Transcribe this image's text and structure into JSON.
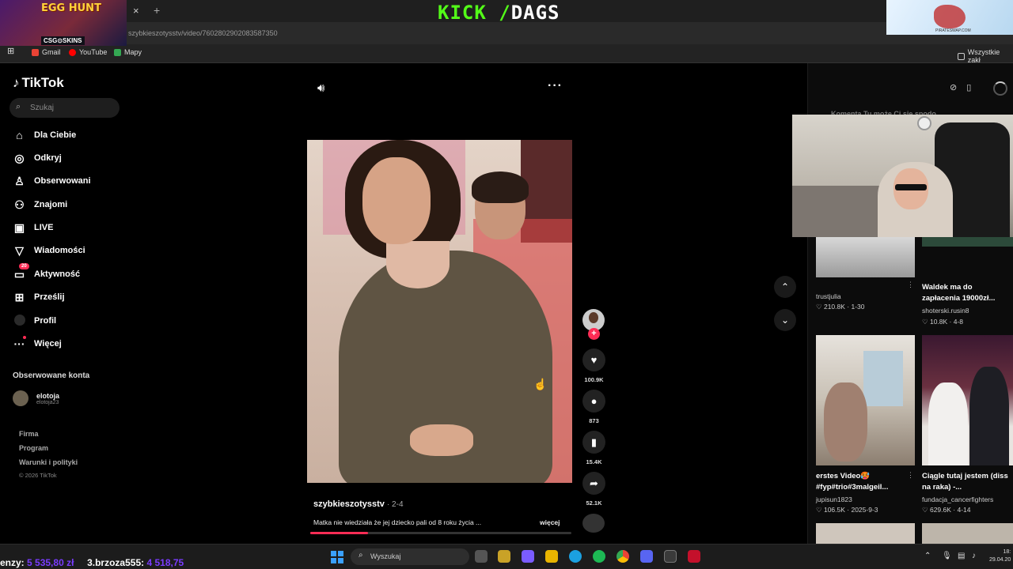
{
  "browser": {
    "tab_close": "×",
    "tab_new": "+",
    "url": "szybkieszotysstv/video/7602802902083587350",
    "bookmarks": [
      "Gmail",
      "YouTube",
      "Mapy"
    ],
    "bookmarks_right": "Wszystkie zakł",
    "apps_icon": "⊞"
  },
  "overlay": {
    "egg_hunt": "EGG HUNT",
    "csgo_skins": "CSG⊙SKINS",
    "kick": "KICK /",
    "dags": "DAGS",
    "corner_tag": "PIRATESWAP.COM"
  },
  "sidebar": {
    "logo": "TikTok",
    "search_placeholder": "Szukaj",
    "nav": [
      {
        "label": "Dla Ciebie",
        "icon": "home-icon"
      },
      {
        "label": "Odkryj",
        "icon": "compass-icon"
      },
      {
        "label": "Obserwowani",
        "icon": "person-icon"
      },
      {
        "label": "Znajomi",
        "icon": "friends-icon"
      },
      {
        "label": "LIVE",
        "icon": "live-icon"
      },
      {
        "label": "Wiadomości",
        "icon": "send-icon"
      },
      {
        "label": "Aktywność",
        "icon": "inbox-icon",
        "badge": "20"
      },
      {
        "label": "Prześlij",
        "icon": "upload-icon"
      },
      {
        "label": "Profil",
        "icon": "profile-icon"
      },
      {
        "label": "Więcej",
        "icon": "more-icon"
      }
    ],
    "followed_title": "Obserwowane konta",
    "followed": {
      "name": "elotoja",
      "handle": "elotoja23"
    },
    "footer": [
      "Firma",
      "Program",
      "Warunki i polityki"
    ],
    "copyright": "© 2026 TikTok"
  },
  "video": {
    "author": "szybkieszotysstv",
    "date": "· 2-4",
    "caption": "Matka nie wiedziała że jej dziecko pali od 8 roku życia ...",
    "more": "więcej",
    "progress_fraction": 0.22,
    "likes": "100.9K",
    "comments": "873",
    "saves": "15.4K",
    "shares": "52.1K"
  },
  "right_panel": {
    "tabs_text": "Komenta Tu może Ci się spodo",
    "items": [
      {
        "caption": "",
        "user": "trustjulia",
        "stats": "♡ 210.8K · 1-30"
      },
      {
        "caption": "Waldek ma do zapłacenia 19000zł...",
        "user": "shoterski.rusin8",
        "stats": "♡ 10.8K · 4-8"
      },
      {
        "caption": "erstes Video🥵 #fyp#trio#3malgeil...",
        "user": "jupisun1823",
        "stats": "♡ 106.5K · 2025-9-3"
      },
      {
        "caption": "Ciągle tutaj jestem (diss na raka) -...",
        "user": "fundacja_cancerfighters",
        "stats": "♡ 629.6K · 4-14"
      }
    ]
  },
  "taskbar": {
    "ticker_a_label": "enzy:",
    "ticker_a_value": "5 535,80 zł",
    "ticker_b_label": "3.brzoza555:",
    "ticker_b_value": "4 518,75",
    "search": "Wyszukaj",
    "clock_time": "18:",
    "clock_date": "29.04.20"
  },
  "colors": {
    "accent": "#fe2c55",
    "kick_green": "#53fc18",
    "windows_blue": "#3aa0ff"
  }
}
